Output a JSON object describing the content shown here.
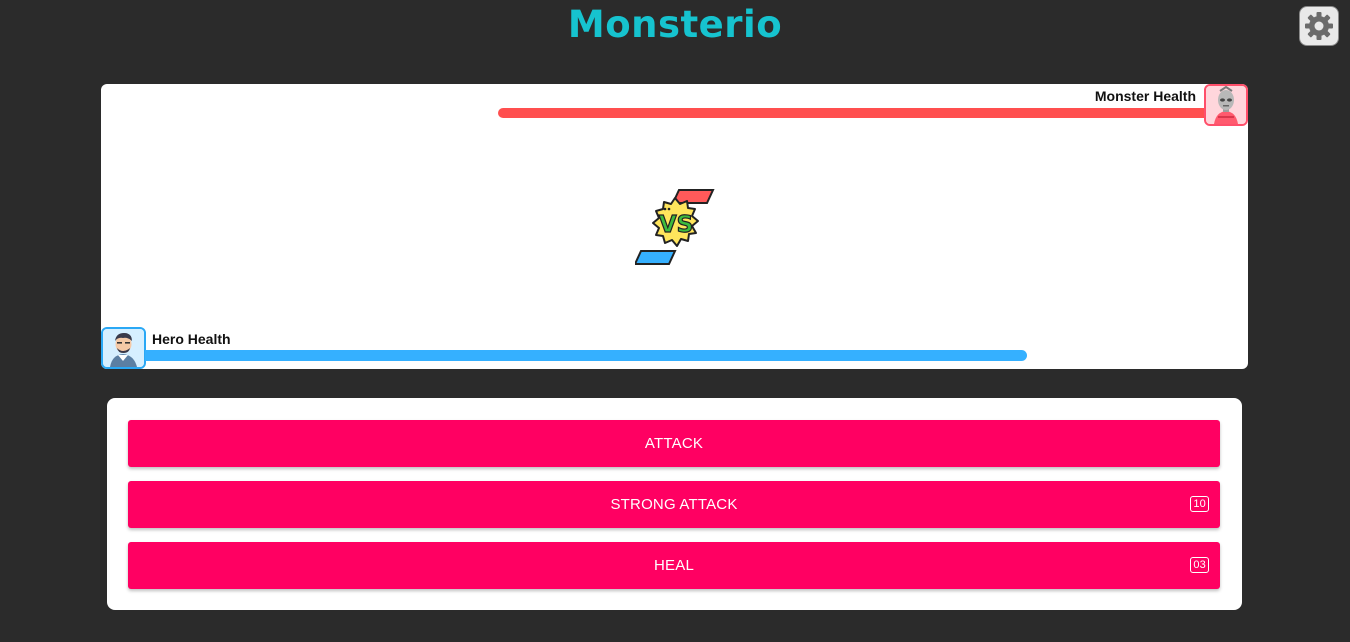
{
  "app": {
    "title": "Monsterio"
  },
  "header": {
    "settings_icon": "gear-icon"
  },
  "arena": {
    "monster": {
      "label": "Monster Health",
      "health_fraction": 0.81,
      "bar_color": "#ff4f4f",
      "avatar_icon": "monster-avatar-icon"
    },
    "versus_icon": "vs-icon",
    "hero": {
      "label": "Hero Health",
      "health_fraction": 1.0,
      "bar_color": "#35b0ff",
      "avatar_icon": "hero-avatar-icon"
    }
  },
  "actions": {
    "attack": {
      "label": "ATTACK"
    },
    "strong_attack": {
      "label": "STRONG ATTACK",
      "count": "10"
    },
    "heal": {
      "label": "HEAL",
      "count": "03"
    }
  },
  "colors": {
    "background": "#2b2b2b",
    "title": "#16c3cf",
    "button": "#ff0062"
  }
}
